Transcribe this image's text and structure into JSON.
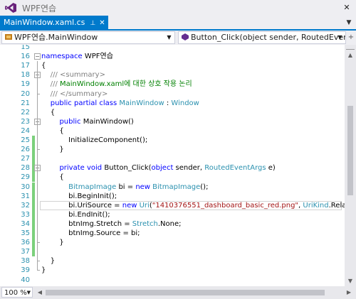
{
  "window": {
    "title": "WPF연습",
    "close_glyph": "✕"
  },
  "tabs": [
    {
      "label": "MainWindow.xaml.cs",
      "pin_glyph": "⊥",
      "close_glyph": "✕",
      "active": true
    }
  ],
  "tab_dropdown_glyph": "▼",
  "nav": {
    "class_combo": "WPF연습.MainWindow",
    "member_combo": "Button_Click(object sender, RoutedEventArgs e)",
    "arrow_glyph": "▼",
    "split_glyph": "+"
  },
  "colors": {
    "accent": "#007acc",
    "line_number": "#2b91af",
    "keyword": "#0000ff",
    "type": "#2b91af",
    "comment": "#008000",
    "string": "#a31515",
    "saved_change": "#7cd07c"
  },
  "code_lines": [
    {
      "n": "15",
      "parts": []
    },
    {
      "n": "16",
      "parts": [
        [
          "kw",
          "namespace"
        ],
        [
          "",
          " WPF연습"
        ]
      ],
      "fold": "−"
    },
    {
      "n": "17",
      "parts": [
        [
          "",
          "{"
        ]
      ]
    },
    {
      "n": "18",
      "parts": [
        [
          "",
          "    "
        ],
        [
          "cmg",
          "/// <summary>"
        ]
      ],
      "fold": "−"
    },
    {
      "n": "19",
      "parts": [
        [
          "",
          "    "
        ],
        [
          "cmg",
          "/// "
        ],
        [
          "cm",
          "MainWindow.xaml에 대한 상호 작용 논리"
        ]
      ]
    },
    {
      "n": "20",
      "parts": [
        [
          "",
          "    "
        ],
        [
          "cmg",
          "/// </summary>"
        ]
      ]
    },
    {
      "n": "21",
      "parts": [
        [
          "",
          "    "
        ],
        [
          "kw",
          "public partial class"
        ],
        [
          "",
          " "
        ],
        [
          "ty",
          "MainWindow"
        ],
        [
          "",
          " : "
        ],
        [
          "ty",
          "Window"
        ]
      ]
    },
    {
      "n": "22",
      "parts": [
        [
          "",
          "    {"
        ]
      ]
    },
    {
      "n": "23",
      "parts": [
        [
          "",
          "        "
        ],
        [
          "kw",
          "public"
        ],
        [
          "",
          " MainWindow()"
        ]
      ],
      "fold": "−"
    },
    {
      "n": "24",
      "parts": [
        [
          "",
          "        {"
        ]
      ]
    },
    {
      "n": "25",
      "parts": [
        [
          "",
          "            InitializeComponent();"
        ]
      ],
      "changed": true
    },
    {
      "n": "26",
      "parts": [
        [
          "",
          "        }"
        ]
      ],
      "changed": true
    },
    {
      "n": "27",
      "parts": [],
      "changed": true
    },
    {
      "n": "28",
      "parts": [
        [
          "",
          "        "
        ],
        [
          "kw",
          "private void"
        ],
        [
          "",
          " Button_Click("
        ],
        [
          "kw",
          "object"
        ],
        [
          "",
          " sender, "
        ],
        [
          "ty",
          "RoutedEventArgs"
        ],
        [
          "",
          " e)"
        ]
      ],
      "fold": "−",
      "changed": true
    },
    {
      "n": "29",
      "parts": [
        [
          "",
          "        {"
        ]
      ],
      "changed": true
    },
    {
      "n": "30",
      "parts": [
        [
          "",
          "            "
        ],
        [
          "ty",
          "BitmapImage"
        ],
        [
          "",
          " bi = "
        ],
        [
          "kw",
          "new"
        ],
        [
          "",
          " "
        ],
        [
          "ty",
          "BitmapImage"
        ],
        [
          "",
          "();"
        ]
      ],
      "changed": true
    },
    {
      "n": "31",
      "parts": [
        [
          "",
          "            bi.BeginInit();"
        ]
      ],
      "changed": true
    },
    {
      "n": "32",
      "parts": [
        [
          "",
          "            bi.UriSource = "
        ],
        [
          "kw",
          "new"
        ],
        [
          "",
          " "
        ],
        [
          "ty",
          "Uri"
        ],
        [
          "",
          "("
        ],
        [
          "st",
          "\"1410376551_dashboard_basic_red.png\""
        ],
        [
          "",
          ", "
        ],
        [
          "ty",
          "UriKind"
        ],
        [
          "",
          ".Relative);"
        ]
      ],
      "changed": true,
      "current": true
    },
    {
      "n": "33",
      "parts": [
        [
          "",
          "            bi.EndInit();"
        ]
      ],
      "changed": true
    },
    {
      "n": "34",
      "parts": [
        [
          "",
          "            btnImg.Stretch = "
        ],
        [
          "ty",
          "Stretch"
        ],
        [
          "",
          ".None;"
        ]
      ],
      "changed": true
    },
    {
      "n": "35",
      "parts": [
        [
          "",
          "            btnImg.Source = bi;"
        ]
      ],
      "changed": true
    },
    {
      "n": "36",
      "parts": [
        [
          "",
          "        }"
        ]
      ],
      "changed": true
    },
    {
      "n": "37",
      "parts": [],
      "changed": true
    },
    {
      "n": "38",
      "parts": [
        [
          "",
          "    }"
        ]
      ]
    },
    {
      "n": "39",
      "parts": [
        [
          "",
          "}"
        ]
      ]
    },
    {
      "n": "40",
      "parts": []
    }
  ],
  "zoom": {
    "value": "100 %",
    "arrow_glyph": "▼"
  },
  "scroll": {
    "up": "▲",
    "down": "▼",
    "left": "◀",
    "right": "▶"
  }
}
